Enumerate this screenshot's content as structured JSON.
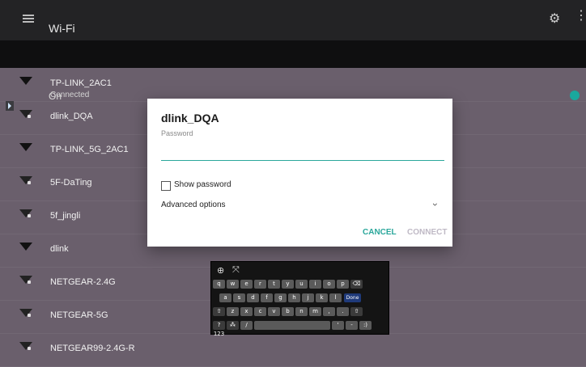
{
  "app": {
    "title": "Wi-Fi"
  },
  "toolbar": {
    "menu_icon": "menu-icon",
    "settings_icon": "settings-icon",
    "more_icon": "more-vert-icon"
  },
  "wifi_toggle": {
    "label": "On",
    "state": "on"
  },
  "networks": [
    {
      "ssid": "TP-LINK_2AC1",
      "status": "Connected"
    },
    {
      "ssid": "dlink_DQA",
      "status": ""
    },
    {
      "ssid": "TP-LINK_5G_2AC1",
      "status": ""
    },
    {
      "ssid": "5F-DaTing",
      "status": ""
    },
    {
      "ssid": "5f_jingli",
      "status": ""
    },
    {
      "ssid": "dlink",
      "status": ""
    },
    {
      "ssid": "NETGEAR-2.4G",
      "status": ""
    },
    {
      "ssid": "NETGEAR-5G",
      "status": ""
    },
    {
      "ssid": "NETGEAR99-2.4G-R",
      "status": ""
    }
  ],
  "dialog": {
    "title": "dlink_DQA",
    "password_label": "Password",
    "password_value": "",
    "show_password_label": "Show password",
    "show_password_checked": false,
    "advanced_label": "Advanced options",
    "cancel_label": "CANCEL",
    "connect_label": "CONNECT"
  },
  "keyboard": {
    "row1": [
      "q",
      "w",
      "e",
      "r",
      "t",
      "y",
      "u",
      "i",
      "o",
      "p",
      "⌫"
    ],
    "row2": [
      "a",
      "s",
      "d",
      "f",
      "g",
      "h",
      "j",
      "k",
      "l",
      "Done"
    ],
    "row3": [
      "⇧",
      "z",
      "x",
      "c",
      "v",
      "b",
      "n",
      "m",
      ",",
      ".",
      "⇧"
    ],
    "row4": [
      "?123",
      "⁂",
      "/",
      " ",
      "'",
      "-",
      ":)"
    ]
  },
  "colors": {
    "accent": "#2aa79b",
    "topbar": "#232325",
    "background": "#6a5f6c"
  }
}
